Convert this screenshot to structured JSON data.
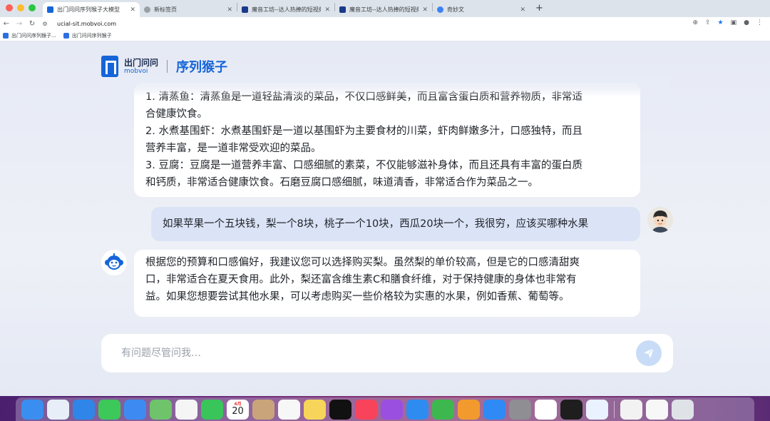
{
  "browser": {
    "tabs": [
      {
        "label": "出门问问序列猴子大模型",
        "active": true,
        "icon": "mobvoi-favicon"
      },
      {
        "label": "新标签页",
        "active": false,
        "icon": "chrome-newtab-icon"
      },
      {
        "label": "魔音工坊--达人热捧的短视频/",
        "active": false,
        "icon": "moyin-favicon"
      },
      {
        "label": "魔音工坊--达人热捧的短视频/",
        "active": false,
        "icon": "moyin-favicon"
      },
      {
        "label": "奇妙文",
        "active": false,
        "icon": "qimiaowen-favicon"
      }
    ],
    "new_tab_label": "+",
    "url": "ucial-sit.mobvoi.com",
    "bookmarks": [
      {
        "label": "出门问问序列猴子..."
      },
      {
        "label": "出门问问序列猴子"
      }
    ]
  },
  "header": {
    "brand_cn": "出门问问",
    "brand_en": "mobvoi",
    "product": "序列猴子"
  },
  "messages": [
    {
      "role": "assistant",
      "lines": [
        "1. 清蒸鱼：清蒸鱼是一道轻盐清淡的菜品，不仅口感鲜美，而且富含蛋白质和营养物质，非常适",
        "合健康饮食。",
        "2. 水煮基围虾：水煮基围虾是一道以基围虾为主要食材的川菜，虾肉鲜嫩多汁，口感独特，而且",
        "营养丰富，是一道非常受欢迎的菜品。",
        "3. 豆腐：豆腐是一道营养丰富、口感细腻的素菜，不仅能够滋补身体，而且还具有丰富的蛋白质",
        "和钙质，非常适合健康饮食。石磨豆腐口感细腻，味道清香，非常适合作为菜品之一。"
      ]
    },
    {
      "role": "user",
      "text": "如果苹果一个五块钱，梨一个8块，桃子一个10块，西瓜20块一个，我很穷，应该买哪种水果"
    },
    {
      "role": "assistant",
      "lines": [
        "根据您的预算和口感偏好，我建议您可以选择购买梨。虽然梨的单价较高，但是它的口感清甜爽",
        "口，非常适合在夏天食用。此外，梨还富含维生素C和膳食纤维，对于保持健康的身体也非常有",
        "益。如果您想要尝试其他水果，可以考虑购买一些价格较为实惠的水果，例如香蕉、葡萄等。"
      ]
    }
  ],
  "input": {
    "placeholder": "有问题尽管问我…"
  },
  "dock": {
    "apps": [
      {
        "name": "finder-icon",
        "color": "#3a8ef0"
      },
      {
        "name": "launchpad-icon",
        "color": "#e8eef7"
      },
      {
        "name": "safari-icon",
        "color": "#2f86e8"
      },
      {
        "name": "messages-icon",
        "color": "#3dc85a"
      },
      {
        "name": "mail-icon",
        "color": "#3d8bf2"
      },
      {
        "name": "maps-icon",
        "color": "#6ec36b"
      },
      {
        "name": "photos-icon",
        "color": "#f5f5f5"
      },
      {
        "name": "facetime-icon",
        "color": "#39c55a"
      },
      {
        "name": "calendar-icon",
        "color": "#ffffff",
        "month": "4月",
        "day": "20"
      },
      {
        "name": "contacts-icon",
        "color": "#c9a47a"
      },
      {
        "name": "reminders-icon",
        "color": "#f7f7f7"
      },
      {
        "name": "notes-icon",
        "color": "#f7d55a"
      },
      {
        "name": "tv-icon",
        "color": "#111111"
      },
      {
        "name": "music-icon",
        "color": "#f8435b"
      },
      {
        "name": "podcasts-icon",
        "color": "#9b4fe0"
      },
      {
        "name": "keynote-icon",
        "color": "#2e8cf0"
      },
      {
        "name": "numbers-icon",
        "color": "#3db84e"
      },
      {
        "name": "pages-icon",
        "color": "#f29a2e"
      },
      {
        "name": "appstore-icon",
        "color": "#2f8af5"
      },
      {
        "name": "settings-icon",
        "color": "#8e8e93"
      },
      {
        "name": "chrome-icon",
        "color": "#ffffff"
      },
      {
        "name": "terminal-icon",
        "color": "#1e1e1e"
      },
      {
        "name": "feishu-icon",
        "color": "#eaf2ff"
      },
      {
        "name": "window-preview-1",
        "color": "#f2f2f2"
      },
      {
        "name": "window-preview-2",
        "color": "#f7f7f7"
      },
      {
        "name": "trash-icon",
        "color": "#dfe3e8"
      }
    ]
  }
}
